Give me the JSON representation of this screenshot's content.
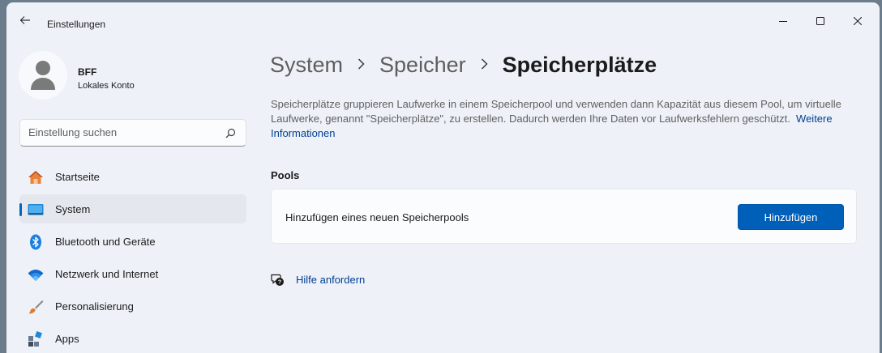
{
  "window": {
    "title": "Einstellungen"
  },
  "user": {
    "name": "BFF",
    "account_type": "Lokales Konto"
  },
  "search": {
    "placeholder": "Einstellung suchen"
  },
  "sidebar": {
    "items": [
      {
        "label": "Startseite",
        "icon": "home-icon",
        "active": false
      },
      {
        "label": "System",
        "icon": "system-icon",
        "active": true
      },
      {
        "label": "Bluetooth und Geräte",
        "icon": "bluetooth-icon",
        "active": false
      },
      {
        "label": "Netzwerk und Internet",
        "icon": "wifi-icon",
        "active": false
      },
      {
        "label": "Personalisierung",
        "icon": "brush-icon",
        "active": false
      },
      {
        "label": "Apps",
        "icon": "apps-icon",
        "active": false
      }
    ]
  },
  "breadcrumb": {
    "level1": "System",
    "level2": "Speicher",
    "current": "Speicherplätze"
  },
  "main": {
    "description": "Speicherplätze gruppieren Laufwerke in einem Speicherpool und verwenden dann Kapazität aus diesem Pool, um virtuelle Laufwerke, genannt \"Speicherplätze\", zu erstellen. Dadurch werden Ihre Daten vor Laufwerksfehlern geschützt.",
    "more_info_link": "Weitere Informationen",
    "pools_heading": "Pools",
    "add_pool_label": "Hinzufügen eines neuen Speicherpools",
    "add_button": "Hinzufügen",
    "help_link": "Hilfe anfordern"
  },
  "colors": {
    "accent": "#005fb8",
    "link": "#003e92",
    "window_bg": "#eef2f8"
  }
}
